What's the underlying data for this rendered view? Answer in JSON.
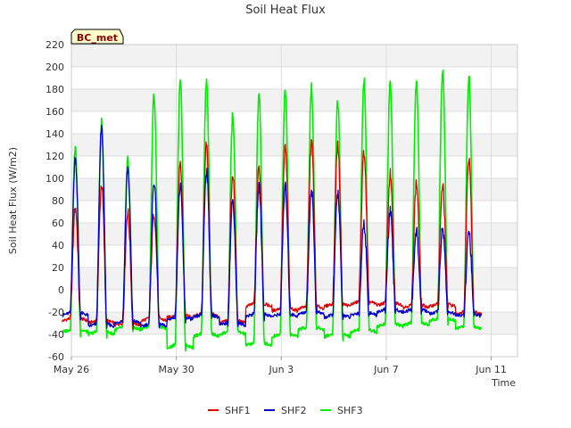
{
  "chart_data": {
    "type": "line",
    "title": "Soil Heat Flux",
    "xlabel": "Time",
    "ylabel": "Soil Heat Flux (W/m2)",
    "badge": "BC_met",
    "xlim": [
      "2023-05-26",
      "2023-06-12"
    ],
    "ylim": [
      -60,
      220
    ],
    "yticks": [
      -60,
      -40,
      -20,
      0,
      20,
      40,
      60,
      80,
      100,
      120,
      140,
      160,
      180,
      200,
      220
    ],
    "xticks": [
      {
        "date": "2023-05-26",
        "label": "May 26"
      },
      {
        "date": "2023-05-30",
        "label": "May 30"
      },
      {
        "date": "2023-06-03",
        "label": "Jun 3"
      },
      {
        "date": "2023-06-07",
        "label": "Jun 7"
      },
      {
        "date": "2023-06-11",
        "label": "Jun 11"
      }
    ],
    "grid": true,
    "legend_position": "bottom",
    "series": [
      {
        "name": "SHF1",
        "color": "#dd0000",
        "daily_max": [
          74,
          94,
          70,
          69,
          116,
          130,
          104,
          110,
          127,
          133,
          130,
          124,
          104,
          96,
          93,
          120
        ],
        "daily_min": [
          -28,
          -30,
          -32,
          -28,
          -25,
          -24,
          -30,
          -15,
          -19,
          -17,
          -15,
          -13,
          -14,
          -16,
          -15,
          -22
        ]
      },
      {
        "name": "SHF2",
        "color": "#0000cc",
        "daily_max": [
          118,
          145,
          110,
          98,
          93,
          108,
          80,
          92,
          92,
          90,
          87,
          60,
          70,
          52,
          55,
          50
        ],
        "daily_min": [
          -23,
          -33,
          -30,
          -33,
          -27,
          -25,
          -32,
          -24,
          -24,
          -22,
          -25,
          -23,
          -20,
          -20,
          -22,
          -24
        ]
      },
      {
        "name": "SHF3",
        "color": "#00ee00",
        "daily_max": [
          126,
          150,
          115,
          176,
          191,
          190,
          157,
          177,
          180,
          181,
          170,
          190,
          188,
          185,
          200,
          192
        ],
        "daily_min": [
          -38,
          -40,
          -36,
          -35,
          -52,
          -42,
          -40,
          -50,
          -42,
          -36,
          -42,
          -38,
          -33,
          -32,
          -28,
          -35
        ]
      }
    ]
  }
}
